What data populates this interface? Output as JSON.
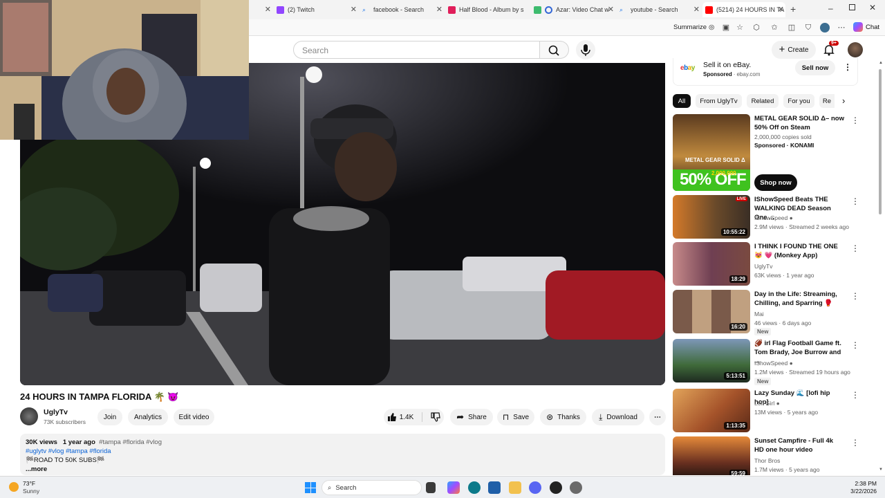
{
  "tabs": [
    {
      "label": "(2) Twitch",
      "color": "#9146ff"
    },
    {
      "label": "facebook - Search",
      "color": "#1a73e8"
    },
    {
      "label": "Half Blood - Album by ѕ",
      "color": "#e01e5a"
    },
    {
      "label": "Azar: Video Chat w",
      "color": "#3dbb6e"
    },
    {
      "label": "youtube - Search",
      "color": "#1a73e8"
    },
    {
      "label": "(5214) 24 HOURS IN TA",
      "color": "#ff0000"
    }
  ],
  "toolbar": {
    "summarize_label": "Summarize",
    "chat_label": "Chat"
  },
  "header": {
    "search_placeholder": "Search",
    "create_label": "Create",
    "notif_count": "9+"
  },
  "ad": {
    "title": "Sell it on eBay.",
    "sponsored": "Sponsored",
    "domain": "ebay.com",
    "logo": "ebay",
    "cta": "Sell now"
  },
  "filters": [
    "All",
    "From UglyTv",
    "Related",
    "For you",
    "Re"
  ],
  "video": {
    "title": "24 HOURS IN TAMPA FLORIDA 🌴 😈",
    "channel": "UglyTv",
    "subs": "73K subscribers",
    "join": "Join",
    "analytics": "Analytics",
    "edit": "Edit video",
    "likes": "1.4K",
    "share": "Share",
    "save": "Save",
    "thanks": "Thanks",
    "download": "Download",
    "views": "30K views",
    "age": "1 year ago",
    "tags": "#tampa #florida #vlog",
    "hashtags": "#uglytv #vlog #tampa #florida",
    "desc_line": "🏁ROAD TO 50K SUBS🏁",
    "more": "...more"
  },
  "recs": [
    {
      "title": "METAL GEAR SOLID Δ– now 50% Off on Steam",
      "line2": "2,000,000 copies sold",
      "line3": "Sponsored · KONAMI",
      "cta": "Shop now",
      "thumb_big": "50% OFF",
      "thumb_small": "2,000,000",
      "thumb_logo": "METAL GEAR SOLID Δ"
    },
    {
      "title": "IShowSpeed Beats THE WALKING DEAD Season One ...",
      "channel": "IShowSpeed",
      "meta": "2.9M views · Streamed 2 weeks ago",
      "dur": "10:55:22",
      "live": "LIVE"
    },
    {
      "title": "I THINK I FOUND THE ONE 😻 💗 (Monkey App)",
      "channel": "UglyTv",
      "meta": "63K views · 1 year ago",
      "dur": "18:29"
    },
    {
      "title": "Day in the Life: Streaming, Chilling, and Sparring 🥊",
      "channel": "Mai",
      "meta": "46 views · 6 days ago",
      "dur": "16:20",
      "badge": "New"
    },
    {
      "title": "🏈 irl Flag Football Game ft. Tom Brady, Joe Burrow and ...",
      "channel": "IShowSpeed",
      "meta": "1.2M views · Streamed 19 hours ago",
      "dur": "5:13:51",
      "badge": "New"
    },
    {
      "title": "Lazy Sunday 🌊 [lofi hip hop]",
      "channel": "Lofi Girl",
      "meta": "13M views · 5 years ago",
      "dur": "1:13:35"
    },
    {
      "title": "Sunset Campfire - Full 4k HD one hour video",
      "channel": "Thor Bros",
      "meta": "1.7M views · 5 years ago",
      "dur": "59:59"
    }
  ],
  "taskbar": {
    "temp": "73°F",
    "weather": "Sunny",
    "search": "Search",
    "time": "2:38 PM",
    "date": "3/22/2026"
  }
}
